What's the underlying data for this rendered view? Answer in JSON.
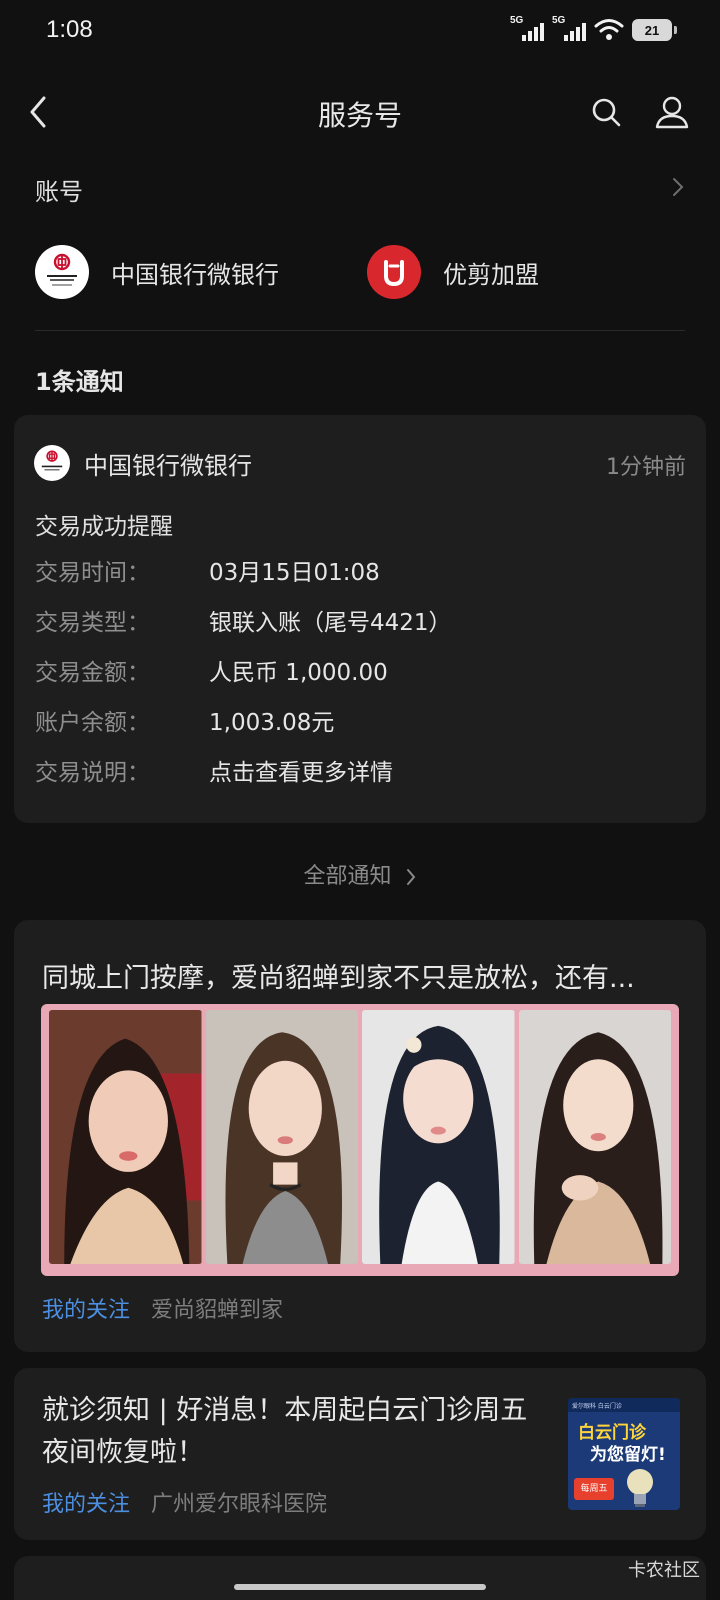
{
  "status_bar": {
    "time": "1:08",
    "signal_1_label": "5G",
    "signal_2_label": "5G",
    "battery": "21"
  },
  "nav": {
    "title": "服务号",
    "back_icon": "back-arrow-icon",
    "search_icon": "search-icon",
    "profile_icon": "person-icon"
  },
  "accounts": {
    "title": "账号",
    "items": [
      {
        "name": "中国银行微银行",
        "logo": "bank-of-china-logo"
      },
      {
        "name": "优剪加盟",
        "logo": "youjian-logo"
      }
    ]
  },
  "notifications": {
    "count_label": "1条通知",
    "card": {
      "sender": "中国银行微银行",
      "time": "1分钟前",
      "title": "交易成功提醒",
      "rows": [
        {
          "key": "交易时间：",
          "value": "03月15日01:08"
        },
        {
          "key": "交易类型：",
          "value": "银联入账（尾号4421）"
        },
        {
          "key": "交易金额：",
          "value": "人民币 1,000.00"
        },
        {
          "key": "账户余额：",
          "value": "1,003.08元"
        },
        {
          "key": "交易说明：",
          "value": "点击查看更多详情"
        }
      ]
    },
    "all_label": "全部通知"
  },
  "articles": [
    {
      "title": "同城上门按摩，爱尚貂蝉到家不只是放松，还有...",
      "follow_label": "我的关注",
      "source": "爱尚貂蝉到家"
    },
    {
      "title": "就诊须知 | 好消息！本周起白云门诊周五夜间恢复啦！",
      "follow_label": "我的关注",
      "source": "广州爱尔眼科医院",
      "thumb": {
        "top": "爱尔眼科 白云门诊",
        "line1": "白云门诊",
        "line2": "为您留灯!",
        "badge": "每周五"
      }
    }
  ],
  "watermark": "卡农社区"
}
